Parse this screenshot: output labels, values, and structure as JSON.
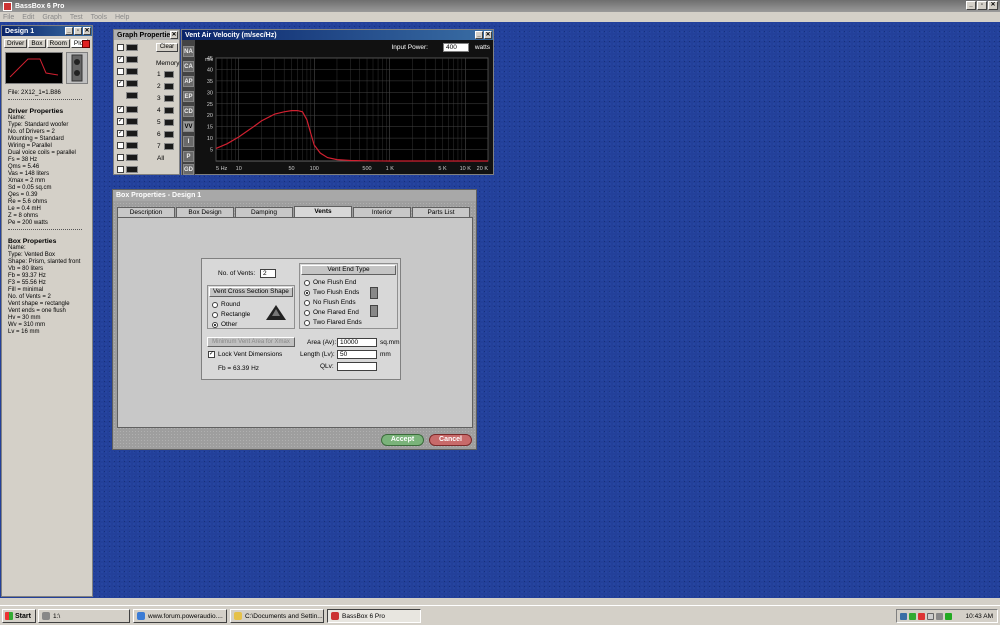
{
  "app": {
    "title": "BassBox 6 Pro",
    "menu": [
      "File",
      "Edit",
      "Graph",
      "Test",
      "Tools",
      "Help"
    ]
  },
  "window_buttons": {
    "minimize": "_",
    "restore": "▫",
    "close": "✕"
  },
  "design": {
    "title": "Design 1",
    "tabs": [
      "Driver",
      "Box",
      "Room",
      "Plot"
    ],
    "file": "File: 2X12_1=1.B86",
    "driver_header": "Driver Properties",
    "driver": [
      "Name:",
      "Type: Standard woofer",
      "No. of Drivers = 2",
      "Mounting = Standard",
      "Wiring = Parallel",
      "Dual voice coils = parallel",
      "Fs = 38 Hz",
      "Qms = 5.46",
      "Vas = 148 liters",
      "Xmax = 2 mm",
      "Sd = 0.05 sq.cm",
      "Qes = 0.39",
      "Re = 5.6 ohms",
      "Le = 0.4 mH",
      "Z = 8 ohms",
      "Pe = 200 watts"
    ],
    "box_header": "Box Properties",
    "box": [
      "Name:",
      "Type: Vented Box",
      "Shape: Prism, slanted front",
      "Vb = 80 liters",
      "Fb = 93.37 Hz",
      "F3 = 55.56 Hz",
      "Fill = minimal",
      "No. of Vents = 2",
      "Vent shape = rectangle",
      "Vent ends = one flush",
      "Hv = 30 mm",
      "Wv = 310 mm",
      "Lv = 16 mm"
    ]
  },
  "graph_props": {
    "title": "Graph Properties",
    "clear": "Clear",
    "memory": "Memory",
    "slots": [
      "1",
      "2",
      "3",
      "4",
      "5",
      "6",
      "7",
      "All"
    ]
  },
  "graph": {
    "title": "Vent Air Velocity (m/sec/Hz)",
    "input_power_label": "Input Power:",
    "input_power": "400",
    "watts": "watts",
    "side_buttons": [
      "NA",
      "CA",
      "AP",
      "EP",
      "CD",
      "VV",
      "I",
      "P",
      "GD"
    ],
    "unit": "m/s"
  },
  "chart_data": {
    "type": "line",
    "title": "Vent Air Velocity (m/sec/Hz)",
    "xscale": "log",
    "xlim": [
      5,
      20000
    ],
    "ylim": [
      0,
      45
    ],
    "x_ticks": [
      "5 Hz",
      "10",
      "50",
      "100",
      "500",
      "1 K",
      "5 K",
      "10 K",
      "20 K"
    ],
    "y_ticks": [
      "5",
      "10",
      "15",
      "20",
      "25",
      "30",
      "35",
      "40",
      "45"
    ],
    "ylabel": "m/s",
    "series": [
      {
        "color": "#d02030",
        "x": [
          5,
          7,
          10,
          15,
          20,
          30,
          40,
          50,
          60,
          70,
          80,
          90,
          100,
          120,
          150,
          200,
          300,
          500,
          1000,
          20000
        ],
        "y": [
          5.5,
          7.5,
          10.5,
          14.5,
          17.5,
          20.5,
          21.5,
          22,
          22,
          21.5,
          18,
          12,
          7,
          3.5,
          1.5,
          0.6,
          0.2,
          0.1,
          0,
          0
        ]
      }
    ]
  },
  "box_dialog": {
    "title": "Box Properties - Design 1",
    "tabs": [
      "Description",
      "Box Design",
      "Damping",
      "Vents",
      "Interior",
      "Parts List"
    ],
    "num_vents_label": "No. of Vents:",
    "num_vents": "2",
    "cross_section_header": "Vent Cross Section Shape",
    "shapes": [
      "Round",
      "Rectangle",
      "Other"
    ],
    "end_type_header": "Vent End Type",
    "ends": [
      "One Flush End",
      "Two Flush Ends",
      "No Flush Ends",
      "One Flared End",
      "Two Flared Ends"
    ],
    "min_area_btn": "Minimum Vent Area for Xmax",
    "lock_label": "Lock Vent Dimensions",
    "fb": "Fb = 63.39 Hz",
    "area_label": "Area (Av):",
    "area": "10000",
    "area_unit": "sq.mm",
    "length_label": "Length (Lv):",
    "length": "50",
    "length_unit": "mm",
    "qlv_label": "QLv:",
    "qlv": "",
    "accept": "Accept",
    "cancel": "Cancel"
  },
  "taskbar": {
    "start": "Start",
    "tasks": [
      "1:\\",
      "www.forum.poweraudio....",
      "C:\\Documents and Settin...",
      "BassBox 6 Pro"
    ],
    "clock": "10:43 AM"
  }
}
